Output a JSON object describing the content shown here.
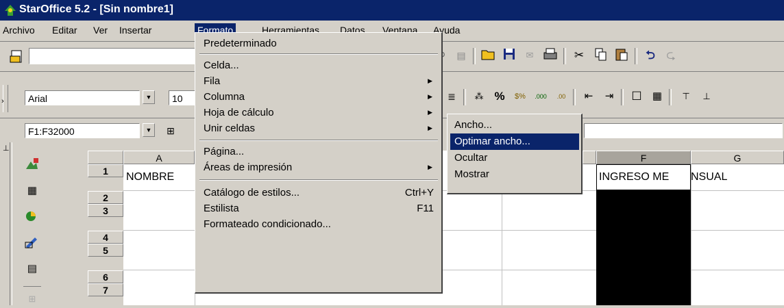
{
  "window": {
    "title": "StarOffice 5.2 - [Sin nombre1]"
  },
  "menubar": {
    "items": [
      {
        "label": "Archivo"
      },
      {
        "label": "Editar"
      },
      {
        "label": "Ver"
      },
      {
        "label": "Insertar"
      },
      {
        "label": "Formato"
      },
      {
        "label": "Herramientas"
      },
      {
        "label": "Datos"
      },
      {
        "label": "Ventana"
      },
      {
        "label": "Ayuda"
      }
    ]
  },
  "toolbar": {
    "font_name": "Arial",
    "font_size": "10",
    "name_box": "F1:F32000"
  },
  "format_menu": {
    "items": [
      {
        "label": "Predeterminado"
      },
      {
        "label": "Celda..."
      },
      {
        "label": "Fila"
      },
      {
        "label": "Columna"
      },
      {
        "label": "Hoja de cálculo"
      },
      {
        "label": "Unir celdas"
      },
      {
        "label": "Página..."
      },
      {
        "label": "Áreas de impresión"
      },
      {
        "label": "Catálogo de estilos...",
        "shortcut": "Ctrl+Y"
      },
      {
        "label": "Estilista",
        "shortcut": "F11"
      },
      {
        "label": "Formateado condicionado..."
      }
    ]
  },
  "column_submenu": {
    "items": [
      {
        "label": "Ancho..."
      },
      {
        "label": "Optimar ancho..."
      },
      {
        "label": "Ocultar"
      },
      {
        "label": "Mostrar"
      }
    ]
  },
  "sheet": {
    "columns": [
      "A",
      "F",
      "G"
    ],
    "rows": [
      "1",
      "2",
      "3",
      "4",
      "5",
      "6",
      "7"
    ],
    "cells": {
      "A1": "NOMBRE",
      "F1": "INGRESO ME",
      "G1": "NSUAL"
    }
  },
  "colors": {
    "selection": "#000000",
    "menu_highlight": "#0a246a",
    "face": "#d4d0c8"
  }
}
